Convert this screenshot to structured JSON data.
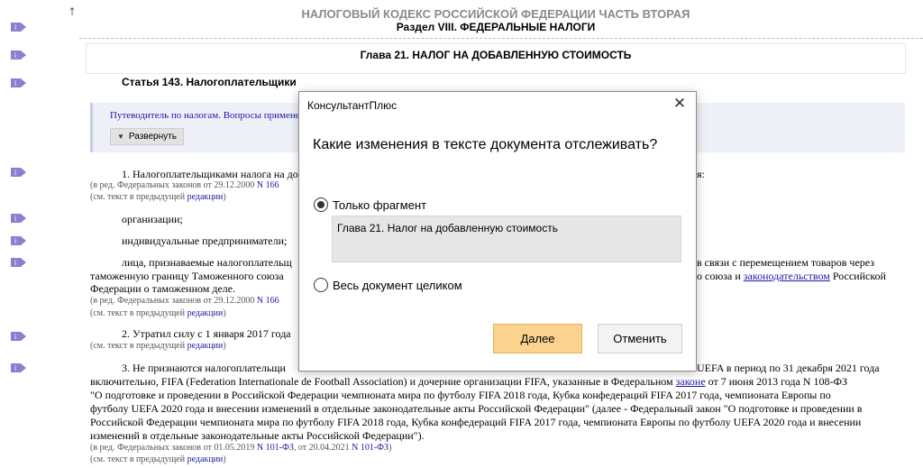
{
  "toolbar": {
    "up_arrow": "↑"
  },
  "header": {
    "code": "НАЛОГОВЫЙ КОДЕКС РОССИЙСКОЙ ФЕДЕРАЦИИ  ЧАСТЬ ВТОРАЯ",
    "section": "Раздел VIII. ФЕДЕРАЛЬНЫЕ НАЛОГИ"
  },
  "chapter": "Глава 21. НАЛОГ НА ДОБАВЛЕННУЮ СТОИМОСТЬ",
  "article": "Статья 143. Налогоплательщики",
  "guide": {
    "link": "Путеводитель по налогам. Вопросы примене",
    "expand": "Развернуть"
  },
  "body": {
    "p1_start": "1. Налогоплательщиками налога на до",
    "p1_end": "я:",
    "ed1_prefix": "(в ред. Федеральных законов от 29.12.2000 ",
    "ed1_link": "N 166",
    "see_prefix": "(см. текст в предыдущей ",
    "see_link": "редакции",
    "see_suffix": ")",
    "item_org": "организации;",
    "item_ip": "индивидуальные предприниматели;",
    "p_lica_start": "лица, признаваемые налогоплательщ",
    "p_lica_end": "в связи с перемещением товаров через",
    "p_lica2_start": "таможенную границу Таможенного союза",
    "p_lica2_mid": "о союза и ",
    "p_lica2_link": "законодательством",
    "p_lica2_end": " Российской",
    "p_lica3": "Федерации о таможенном деле.",
    "ed2_prefix": "(в ред. Федеральных законов от 29.12.2000 ",
    "ed2_link": "N 166",
    "p2": "2. Утратил силу с 1 января 2017 года",
    "p3_start": "3. Не признаются налогоплательщи",
    "p3_end": "UEFA в период по 31 декабря 2021 года",
    "p3_l2_a": "включительно, FIFA (Federation Internationale de Football Association) и дочерние организации FIFA, указанные в Федеральном ",
    "p3_l2_link": "законе",
    "p3_l2_b": " от 7 июня 2013 года N 108-ФЗ",
    "p3_l3": "\"О подготовке и проведении в Российской Федерации чемпионата мира по футболу FIFA 2018 года, Кубка конфедераций FIFA 2017 года, чемпионата Европы по",
    "p3_l4": "футболу UEFA 2020 года и внесении изменений в отдельные законодательные акты Российской Федерации\" (далее - Федеральный закон \"О подготовке и проведении в",
    "p3_l5": "Российской Федерации чемпионата мира по футболу FIFA 2018 года, Кубка конфедераций FIFA 2017 года, чемпионата Европы по футболу UEFA 2020 года и внесении",
    "p3_l6": "изменений в отдельные законодательные акты Российской Федерации\").",
    "ed3_prefix": "(в ред. Федеральных законов от 01.05.2019 ",
    "ed3_link1": "N 101-ФЗ",
    "ed3_mid": ", от 20.04.2021 ",
    "ed3_link2": "N 101-ФЗ",
    "ed3_suffix": ")"
  },
  "dialog": {
    "title": "КонсультантПлюс",
    "close": "✕",
    "question": "Какие изменения в тексте документа отслеживать?",
    "option_fragment": "Только фрагмент",
    "fragment_text": "Глава 21. Налог на добавленную стоимость",
    "option_whole": "Весь документ целиком",
    "next": "Далее",
    "cancel": "Отменить"
  },
  "colors": {
    "accent_button": "#fbd38f",
    "marker": "#8b7fd0",
    "link": "#1a1aa6"
  },
  "icons": [
    "info-marker-icon",
    "up-arrow-icon",
    "chevron-down-icon",
    "close-icon"
  ]
}
